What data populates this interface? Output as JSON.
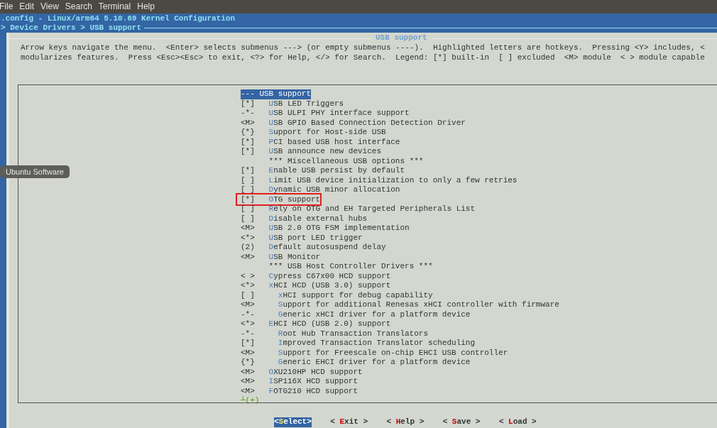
{
  "menu_bar": [
    "File",
    "Edit",
    "View",
    "Search",
    "Terminal",
    "Help"
  ],
  "title": ".config - Linux/arm64 5.10.69 Kernel Configuration",
  "breadcrumb": "> Device Drivers > USB support",
  "dialog": {
    "title": "USB support",
    "help": [
      "Arrow keys navigate the menu.  <Enter> selects submenus ---> (or empty submenus ----).  Highlighted letters are hotkeys.  Pressing <Y> includes, <",
      "modularizes features.  Press <Esc><Esc> to exit, <?> for Help, </> for Search.  Legend: [*] built-in  [ ] excluded  <M> module  < > module capable"
    ],
    "items": [
      {
        "kind": "header",
        "label": "--- USB support",
        "selected": true
      },
      {
        "kind": "option",
        "state": "[*]",
        "label": "**U**SB LED Triggers",
        "selected": false
      },
      {
        "kind": "option",
        "state": "-*-",
        "label": "**U**SB ULPI PHY interface support",
        "selected": false
      },
      {
        "kind": "option",
        "state": "<M>",
        "label": "**U**SB GPIO Based Connection Detection Driver",
        "selected": false
      },
      {
        "kind": "option",
        "state": "{*}",
        "label": "**S**upport for Host-side USB",
        "selected": false
      },
      {
        "kind": "option",
        "state": "[*]",
        "label": "**P**CI based USB host interface",
        "selected": false
      },
      {
        "kind": "option",
        "state": "[*]",
        "label": "**U**SB announce new devices",
        "selected": false
      },
      {
        "kind": "comment",
        "label": "*** Miscellaneous USB options ***"
      },
      {
        "kind": "option",
        "state": "[*]",
        "label": "**E**nable USB persist by default",
        "selected": false
      },
      {
        "kind": "option",
        "state": "[ ]",
        "label": "**L**imit USB device initialization to only a few retries",
        "selected": false
      },
      {
        "kind": "option",
        "state": "[ ]",
        "label": "**D**ynamic USB minor allocation",
        "selected": false
      },
      {
        "kind": "option",
        "state": "[*]",
        "label": "**O**TG support",
        "selected": false,
        "annotated": true
      },
      {
        "kind": "option",
        "state": "[ ]",
        "label": "**R**ely on OTG and EH Targeted Peripherals List",
        "selected": false
      },
      {
        "kind": "option",
        "state": "[ ]",
        "label": "**D**isable external hubs",
        "selected": false
      },
      {
        "kind": "option",
        "state": "<M>",
        "label": "**U**SB 2.0 OTG FSM implementation",
        "selected": false
      },
      {
        "kind": "option",
        "state": "<*>",
        "label": "**U**SB port LED trigger",
        "selected": false
      },
      {
        "kind": "option",
        "state": "(2)",
        "label": "**D**efault autosuspend delay",
        "selected": false
      },
      {
        "kind": "option",
        "state": "<M>",
        "label": "**U**SB Monitor",
        "selected": false
      },
      {
        "kind": "comment",
        "label": "*** USB Host Controller Drivers ***"
      },
      {
        "kind": "option",
        "state": "< >",
        "label": "**C**ypress C67x00 HCD support",
        "selected": false
      },
      {
        "kind": "option",
        "state": "<*>",
        "label": "**x**HCI HCD (USB 3.0) support",
        "selected": false,
        "children": [
          {
            "kind": "option",
            "state": "[ ]",
            "label": "**x**HCI support for debug capability",
            "selected": false
          },
          {
            "kind": "option",
            "state": "<M>",
            "label": "**S**upport for additional Renesas xHCI controller with firmware",
            "selected": false
          },
          {
            "kind": "option",
            "state": "-*-",
            "label": "**G**eneric xHCI driver for a platform device",
            "selected": false
          }
        ]
      },
      {
        "kind": "option",
        "state": "<*>",
        "label": "**E**HCI HCD (USB 2.0) support",
        "selected": false,
        "children": [
          {
            "kind": "option",
            "state": "-*-",
            "label": "**R**oot Hub Transaction Translators",
            "selected": false
          },
          {
            "kind": "option",
            "state": "[*]",
            "label": "**I**mproved Transaction Translator scheduling",
            "selected": false
          },
          {
            "kind": "option",
            "state": "<M>",
            "label": "**S**upport for Freescale on-chip EHCI USB controller",
            "selected": false
          },
          {
            "kind": "option",
            "state": "{*}",
            "label": "**G**eneric EHCI driver for a platform device",
            "selected": false
          }
        ]
      },
      {
        "kind": "option",
        "state": "<M>",
        "label": "**O**XU210HP HCD support",
        "selected": false
      },
      {
        "kind": "option",
        "state": "<M>",
        "label": "**I**SP116X HCD support",
        "selected": false
      },
      {
        "kind": "option",
        "state": "<M>",
        "label": "**F**OTG210 HCD support",
        "selected": false
      }
    ],
    "more_indicator": "┴(+)",
    "buttons": [
      {
        "label": "<**S**elect>",
        "selected": true
      },
      {
        "label": "< **E**xit >",
        "selected": false
      },
      {
        "label": "< **H**elp >",
        "selected": false
      },
      {
        "label": "< **S**ave >",
        "selected": false
      },
      {
        "label": "< **L**oad >",
        "selected": false
      }
    ]
  },
  "tooltip": "Ubuntu Software"
}
